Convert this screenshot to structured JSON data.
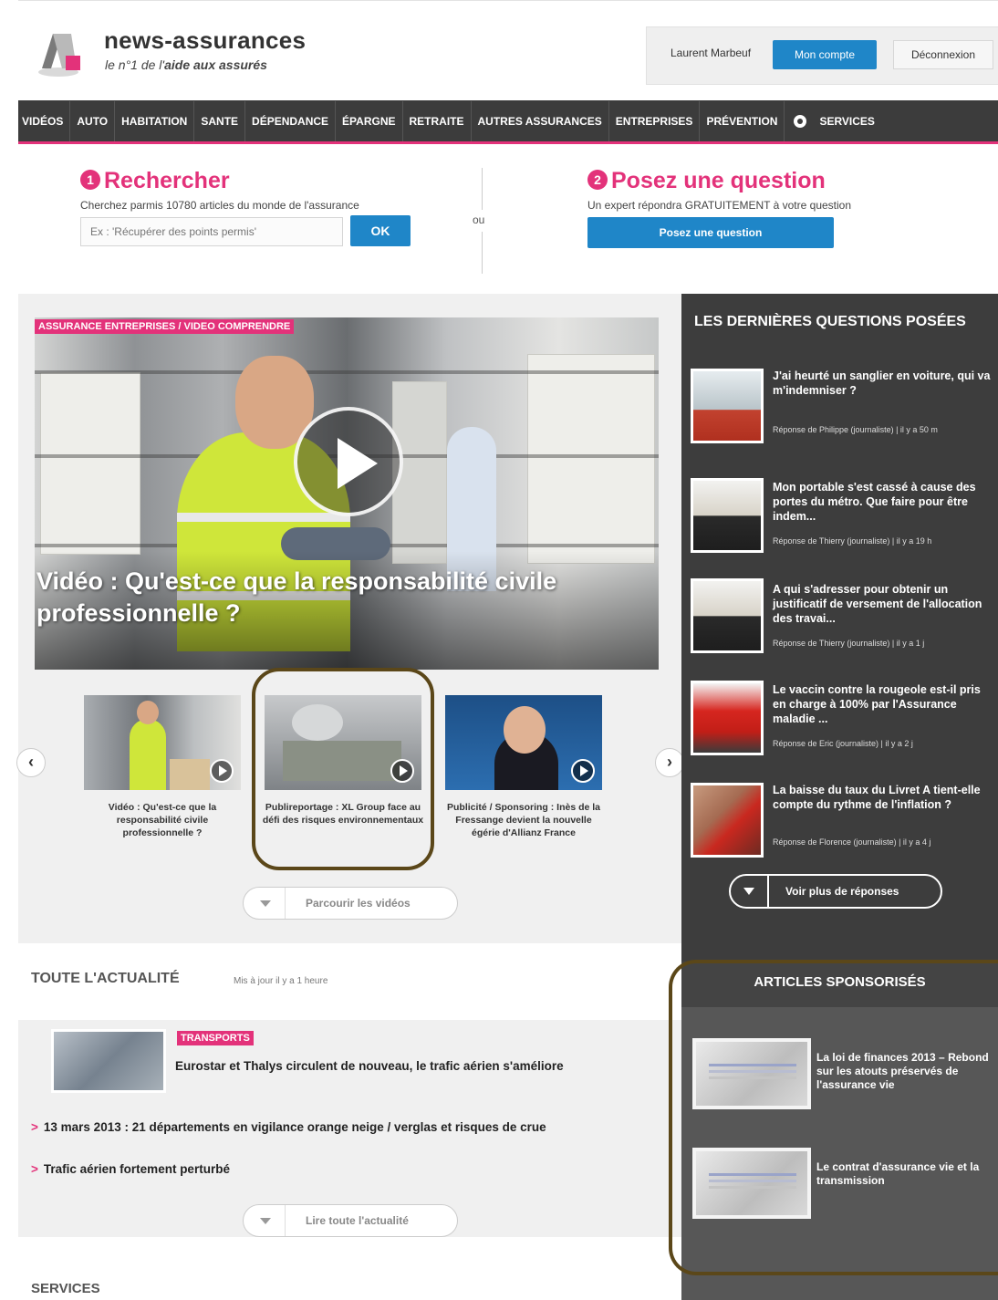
{
  "header": {
    "site_name": "news-assurances",
    "tagline_prefix": "le n°1 de l'",
    "tagline_bold": "aide aux assurés",
    "user_name": "Laurent Marbeuf",
    "account_label": "Mon compte",
    "logout_label": "Déconnexion"
  },
  "nav": {
    "items": [
      "VIDÉOS",
      "AUTO",
      "HABITATION",
      "SANTE",
      "DÉPENDANCE",
      "ÉPARGNE",
      "RETRAITE",
      "AUTRES ASSURANCES",
      "ENTREPRISES",
      "PRÉVENTION"
    ],
    "services_label": "SERVICES"
  },
  "search": {
    "step": "1",
    "title": "Rechercher",
    "subtitle": "Cherchez parmis 10780 articles du monde de l'assurance",
    "placeholder": "Ex : 'Récupérer des points permis'",
    "ok_label": "OK"
  },
  "or_label": "ou",
  "ask": {
    "step": "2",
    "title": "Posez une question",
    "subtitle": "Un expert répondra GRATUITEMENT à votre question",
    "button_label": "Posez une question"
  },
  "hero": {
    "tag": "ASSURANCE ENTREPRISES / VIDEO COMPRENDRE",
    "title": "Vidéo : Qu'est-ce que la responsabilité civile professionnelle ?"
  },
  "carousel": {
    "prev_label": "‹",
    "next_label": "›",
    "captions": [
      "Vidéo : Qu'est-ce que la responsabilité civile professionnelle ?",
      "Publireportage : XL Group face au défi des risques environnementaux",
      "Publicité / Sponsoring : Inès de la Fressange devient la nouvelle égérie d'Allianz France"
    ],
    "browse_label": "Parcourir les vidéos"
  },
  "news": {
    "title": "TOUTE L'ACTUALITÉ",
    "updated": "Mis à jour il y a 1 heure",
    "category": "TRANSPORTS",
    "headline": "Eurostar et Thalys circulent de nouveau, le trafic aérien s'améliore",
    "links": [
      "13 mars 2013 : 21 départements en vigilance orange neige / verglas et risques de crue",
      "Trafic aérien fortement perturbé"
    ],
    "read_all_label": "Lire toute l'actualité"
  },
  "services": {
    "title": "SERVICES"
  },
  "sidebar": {
    "questions_title": "LES DERNIÈRES QUESTIONS POSÉES",
    "questions": [
      {
        "text": "J'ai heurté un sanglier en voiture, qui va m'indemniser ?",
        "meta": "Réponse de Philippe (journaliste) | il y a 50 m"
      },
      {
        "text": "Mon portable s'est cassé à cause des portes du métro. Que faire pour être indem...",
        "meta": "Réponse de Thierry (journaliste) | il y a 19 h"
      },
      {
        "text": "A qui s'adresser pour obtenir un justificatif de versement de l'allocation des travai...",
        "meta": "Réponse de Thierry (journaliste) | il y a 1 j"
      },
      {
        "text": "Le vaccin contre la rougeole est-il pris en charge à 100% par l'Assurance maladie ...",
        "meta": "Réponse de Eric (journaliste) | il y a 2 j"
      },
      {
        "text": "La baisse du taux du Livret A tient-elle compte du rythme de l'inflation ?",
        "meta": "Réponse de Florence (journaliste) | il y a 4 j"
      }
    ],
    "more_label": "Voir plus de réponses",
    "sponsored_title": "ARTICLES SPONSORISÉS",
    "sponsored": [
      "La loi de finances 2013 – Rebond sur les atouts préservés de l'assurance vie",
      "Le contrat d'assurance vie et la transmission"
    ]
  },
  "colors": {
    "accent_pink": "#e3327a",
    "button_blue": "#1f86c8",
    "nav_dark": "#3c3c3c",
    "highlight_brown": "#5b4719"
  }
}
